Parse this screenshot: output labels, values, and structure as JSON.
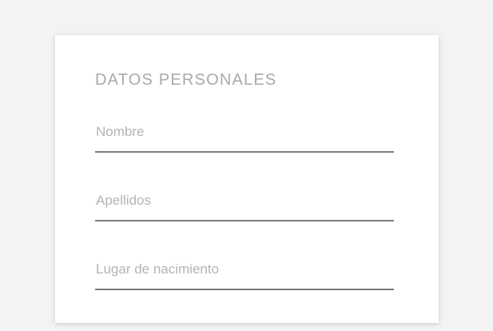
{
  "form": {
    "section_title": "DATOS PERSONALES",
    "fields": [
      {
        "placeholder": "Nombre",
        "value": ""
      },
      {
        "placeholder": "Apellidos",
        "value": ""
      },
      {
        "placeholder": "Lugar de nacimiento",
        "value": ""
      }
    ]
  },
  "colors": {
    "background": "#f3f3f3",
    "card": "#ffffff",
    "title_text": "#a9a9a9",
    "placeholder_text": "#b4b4b4",
    "underline": "#7b7b7b"
  }
}
